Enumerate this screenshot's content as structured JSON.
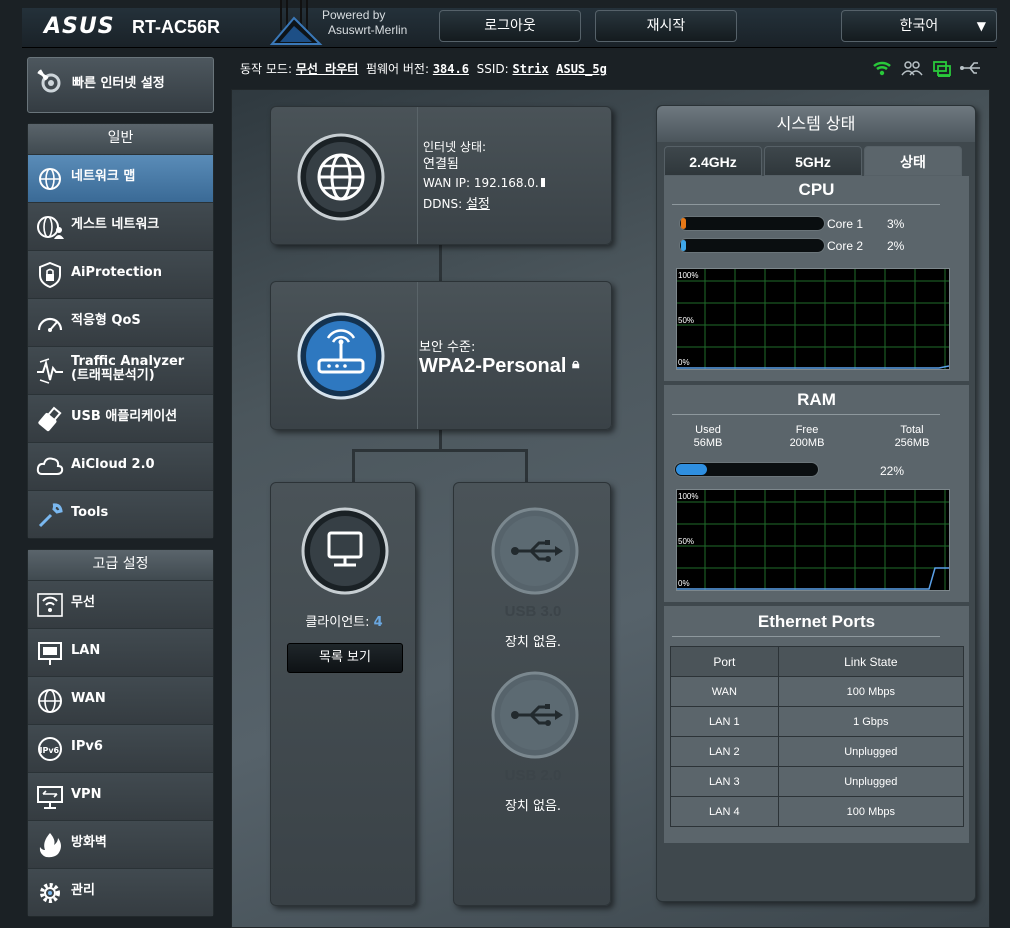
{
  "header": {
    "brand": "ASUS",
    "model": "RT-AC56R",
    "powered_by": "Powered by",
    "firmware_name": "Asuswrt-Merlin",
    "logout": "로그아웃",
    "reboot": "재시작",
    "language": "한국어"
  },
  "status_line": {
    "mode_label": "동작 모드:",
    "mode_value": "무선 라우터",
    "fw_label": "펌웨어 버전:",
    "fw_value": "384.6",
    "ssid_label": "SSID:",
    "ssid_1": "Strix",
    "ssid_2": "ASUS_5g"
  },
  "sidebar": {
    "quick_setup": "빠른 인터넷 설정",
    "general_title": "일반",
    "general_items": [
      {
        "label": "네트워크 맵",
        "icon": "network-map"
      },
      {
        "label": "게스트 네트워크",
        "icon": "guest-network"
      },
      {
        "label": "AiProtection",
        "icon": "shield"
      },
      {
        "label": "적응형 QoS",
        "icon": "gauge"
      },
      {
        "label": "Traffic Analyzer",
        "label2": "(트래픽분석기)",
        "icon": "pulse"
      },
      {
        "label": "USB 애플리케이션",
        "icon": "usb"
      },
      {
        "label": "AiCloud 2.0",
        "icon": "cloud"
      },
      {
        "label": "Tools",
        "icon": "wrench"
      }
    ],
    "advanced_title": "고급 설정",
    "advanced_items": [
      {
        "label": "무선",
        "icon": "wireless"
      },
      {
        "label": "LAN",
        "icon": "lan"
      },
      {
        "label": "WAN",
        "icon": "globe"
      },
      {
        "label": "IPv6",
        "icon": "ipv6"
      },
      {
        "label": "VPN",
        "icon": "vpn"
      },
      {
        "label": "방화벽",
        "icon": "fire"
      },
      {
        "label": "관리",
        "icon": "gear"
      }
    ]
  },
  "map": {
    "internet_status_label": "인터넷 상태:",
    "internet_status_value": "연결됨",
    "wan_ip_label": "WAN IP:",
    "wan_ip_value": "192.168.0.",
    "ddns_label": "DDNS:",
    "ddns_value": "설정",
    "security_label": "보안 수준:",
    "security_value": "WPA2-Personal",
    "clients_label": "클라이언트:",
    "clients_count": "4",
    "list_button": "목록 보기",
    "usb3_title": "USB 3.0",
    "usb3_status": "장치 없음.",
    "usb2_title": "USB 2.0",
    "usb2_status": "장치 없음."
  },
  "system_status": {
    "title": "시스템 상태",
    "tabs": [
      "2.4GHz",
      "5GHz",
      "상태"
    ],
    "active_tab": "상태",
    "cpu_title": "CPU",
    "cpu_cores": [
      {
        "name": "Core 1",
        "percent": "3%",
        "value": 3,
        "color": "#e77817"
      },
      {
        "name": "Core 2",
        "percent": "2%",
        "value": 2,
        "color": "#3fa7ea"
      }
    ],
    "graph_labels": {
      "top": "100%",
      "mid": "50%",
      "bottom": "0%"
    },
    "ram_title": "RAM",
    "ram": {
      "used_label": "Used",
      "used_value": "56MB",
      "free_label": "Free",
      "free_value": "200MB",
      "total_label": "Total",
      "total_value": "256MB",
      "percent": "22%",
      "value": 22
    },
    "ethernet_title": "Ethernet Ports",
    "ethernet_headers": [
      "Port",
      "Link State"
    ],
    "ethernet_rows": [
      [
        "WAN",
        "100 Mbps"
      ],
      [
        "LAN 1",
        "1 Gbps"
      ],
      [
        "LAN 2",
        "Unplugged"
      ],
      [
        "LAN 3",
        "Unplugged"
      ],
      [
        "LAN 4",
        "100 Mbps"
      ]
    ]
  },
  "colors": {
    "accent_blue": "#3a6a96",
    "link_green": "#29c83a",
    "client_count": "#6aa7e0"
  }
}
